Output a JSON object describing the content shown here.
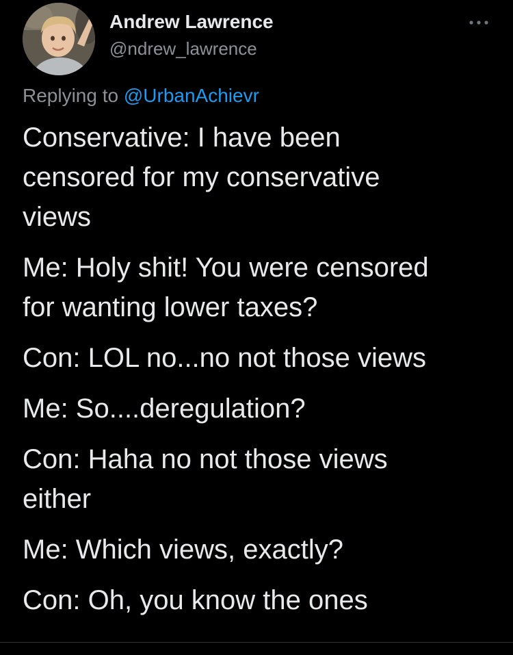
{
  "tweet": {
    "author": {
      "display_name": "Andrew Lawrence",
      "handle": "@ndrew_lawrence",
      "avatar_icon": "profile-photo-child"
    },
    "more_icon": "more-horizontal-icon",
    "reply": {
      "prefix": "Replying to ",
      "mention": "@UrbanAchievr"
    },
    "paragraphs": [
      "Conservative: I have been\ncensored for my conservative\nviews",
      "Me: Holy shit! You were censored\nfor wanting lower taxes?",
      "Con: LOL no...no not those views",
      "Me: So....deregulation?",
      "Con: Haha no not those views\neither",
      "Me: Which views, exactly?",
      "Con: Oh, you know the ones"
    ]
  },
  "colors": {
    "background": "#000000",
    "text": "#e7e9ea",
    "secondary_text": "#8b9197",
    "link": "#1d9bf0"
  }
}
